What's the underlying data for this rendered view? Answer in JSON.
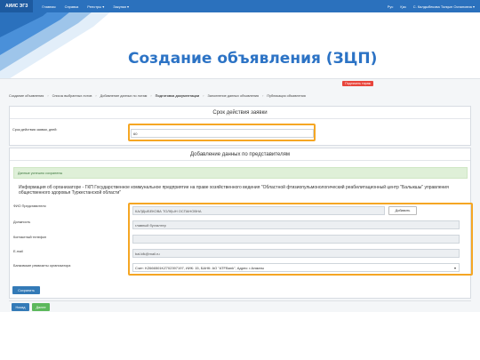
{
  "slide": {
    "title": "Создание объявления (ЗЦП)"
  },
  "nav": {
    "brand": "АИИС ЭГЗ",
    "items": [
      "Главная",
      "Справка",
      "Реестры ▾",
      "Закупки ▾"
    ],
    "right": [
      "Рус",
      "Қаз",
      "С. Калдыбекова Толқын Оспановна ▾"
    ]
  },
  "topbar": {
    "submit_label": "Подписать тираж"
  },
  "breadcrumbs": [
    "Создание объявления",
    "Список выбранных лотов",
    "Добавление данных по лотам",
    "Подготовка документации",
    "Заполнение данных объявления",
    "Публикация объявления"
  ],
  "deadline": {
    "header": "Срок действия заявки",
    "field_label": "Срок действия заявки, дней:",
    "field_value": "60"
  },
  "representative": {
    "header": "Добавление данных по представителям",
    "alert": "Данные успешно сохранены",
    "org_info": "Информация об организаторе - ГКП Государственное коммунальное предприятие на праве хозяйственного ведения \"Областной фтизиопульмонологический реабилитационный центр \"Балыкшы\" управления общественного здоровья Туркестанской области\"",
    "fio_label": "ФИО Представителя",
    "fio_value": "КАЛДЫБЕКОВА ТОЛҚЫН ОСПАНОВНА",
    "add_label": "Добавить",
    "position_label": "Должность",
    "position_value": "главный бухгалтер",
    "phone_label": "Контактный телефон",
    "phone_value": "",
    "email_label": "E-mail",
    "email_value": "bal.kfk@mail.ru",
    "bank_label": "Банковские реквизиты организатора",
    "bank_value": "Счет: KZ666501KZ702397197, ИИК: 15, БАНК: АО \"ATFBank\", Адрес: г.Алматы"
  },
  "buttons": {
    "save": "Сохранить",
    "back": "Назад",
    "next": "Далее"
  },
  "colors": {
    "accent": "#2c73c5",
    "highlight": "#f5a623",
    "success": "#dff0d8"
  }
}
